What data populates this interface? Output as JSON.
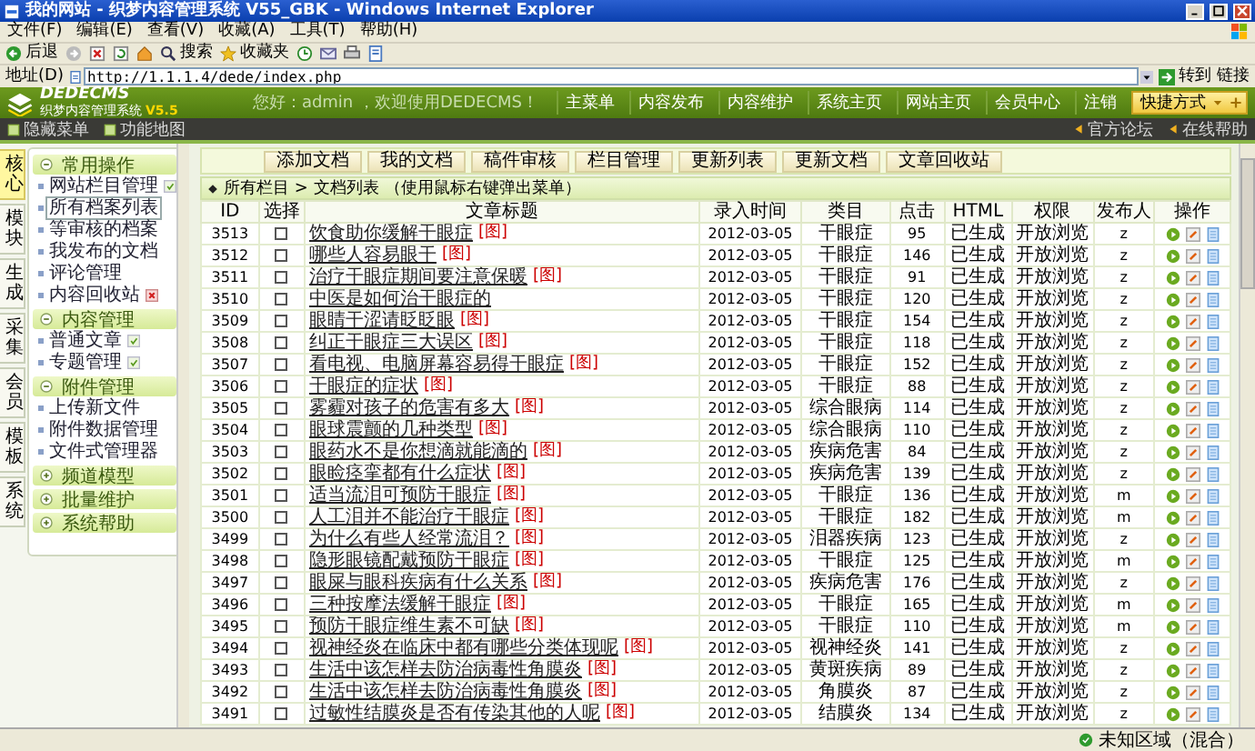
{
  "browser": {
    "title": "我的网站 - 织梦内容管理系统 V55_GBK - Windows Internet Explorer",
    "menu": [
      "文件(F)",
      "编辑(E)",
      "查看(V)",
      "收藏(A)",
      "工具(T)",
      "帮助(H)"
    ],
    "back": "后退",
    "search": "搜索",
    "favorites": "收藏夹",
    "address_label": "地址(D)",
    "url": "http://1.1.1.4/dede/index.php",
    "go": "转到",
    "links": "链接",
    "status": "未知区域（混合）"
  },
  "header": {
    "logo": "DEDECMS",
    "subtitle": "织梦内容管理系统",
    "version": "V5.5",
    "greeting": "您好：admin ，欢迎使用DEDECMS！",
    "nav": [
      "主菜单",
      "内容发布",
      "内容维护",
      "系统主页",
      "网站主页",
      "会员中心",
      "注销"
    ],
    "shortcut": "快捷方式"
  },
  "subbar": {
    "left": [
      "隐藏菜单",
      "功能地图"
    ],
    "right": [
      "官方论坛",
      "在线帮助"
    ]
  },
  "side_tabs": [
    {
      "label": "核心",
      "selected": true
    },
    {
      "label": "模块",
      "selected": false
    },
    {
      "label": "生成",
      "selected": false
    },
    {
      "label": "采集",
      "selected": false
    },
    {
      "label": "会员",
      "selected": false
    },
    {
      "label": "模板",
      "selected": false
    },
    {
      "label": "系统",
      "selected": false
    }
  ],
  "menu_groups": [
    {
      "title": "常用操作",
      "expanded": true,
      "items": [
        {
          "label": "网站栏目管理",
          "kind": "add",
          "selected": false
        },
        {
          "label": "所有档案列表",
          "kind": "plain",
          "selected": true
        },
        {
          "label": "等审核的档案",
          "kind": "plain",
          "selected": false
        },
        {
          "label": "我发布的文档",
          "kind": "plain",
          "selected": false
        },
        {
          "label": "评论管理",
          "kind": "plain",
          "selected": false
        },
        {
          "label": "内容回收站",
          "kind": "delete",
          "selected": false
        }
      ]
    },
    {
      "title": "内容管理",
      "expanded": true,
      "items": [
        {
          "label": "普通文章",
          "kind": "add",
          "selected": false
        },
        {
          "label": "专题管理",
          "kind": "add",
          "selected": false
        }
      ]
    },
    {
      "title": "附件管理",
      "expanded": true,
      "items": [
        {
          "label": "上传新文件",
          "kind": "plain",
          "selected": false
        },
        {
          "label": "附件数据管理",
          "kind": "plain",
          "selected": false
        },
        {
          "label": "文件式管理器",
          "kind": "plain",
          "selected": false
        }
      ]
    },
    {
      "title": "频道模型",
      "expanded": false
    },
    {
      "title": "批量维护",
      "expanded": false
    },
    {
      "title": "系统帮助",
      "expanded": false
    }
  ],
  "toolbar_buttons": [
    "添加文档",
    "我的文档",
    "稿件审核",
    "栏目管理",
    "更新列表",
    "更新文档",
    "文章回收站"
  ],
  "breadcrumb": "所有栏目 > 文档列表",
  "hint": "（使用鼠标右键弹出菜单）",
  "table": {
    "columns": [
      "ID",
      "选择",
      "文章标题",
      "录入时间",
      "类目",
      "点击",
      "HTML",
      "权限",
      "发布人",
      "操作"
    ],
    "rows": [
      {
        "id": "3513",
        "checked": false,
        "title": "饮食助你缓解干眼症",
        "flag": "[图]",
        "date": "2012-03-05",
        "category": "干眼症",
        "clicks": "95",
        "html": "已生成",
        "access": "开放浏览",
        "author": "z"
      },
      {
        "id": "3512",
        "checked": false,
        "title": "哪些人容易眼干",
        "flag": "[图]",
        "date": "2012-03-05",
        "category": "干眼症",
        "clicks": "146",
        "html": "已生成",
        "access": "开放浏览",
        "author": "z"
      },
      {
        "id": "3511",
        "checked": false,
        "title": "治疗干眼症期间要注意保暖",
        "flag": "[图]",
        "date": "2012-03-05",
        "category": "干眼症",
        "clicks": "91",
        "html": "已生成",
        "access": "开放浏览",
        "author": "z"
      },
      {
        "id": "3510",
        "checked": false,
        "title": "中医是如何治干眼症的",
        "date": "2012-03-05",
        "category": "干眼症",
        "clicks": "120",
        "html": "已生成",
        "access": "开放浏览",
        "author": "z"
      },
      {
        "id": "3509",
        "checked": false,
        "title": "眼睛干涩请眨眨眼",
        "flag": "[图]",
        "date": "2012-03-05",
        "category": "干眼症",
        "clicks": "154",
        "html": "已生成",
        "access": "开放浏览",
        "author": "z"
      },
      {
        "id": "3508",
        "checked": false,
        "title": "纠正干眼症三大误区",
        "flag": "[图]",
        "date": "2012-03-05",
        "category": "干眼症",
        "clicks": "118",
        "html": "已生成",
        "access": "开放浏览",
        "author": "z"
      },
      {
        "id": "3507",
        "checked": false,
        "title": "看电视、电脑屏幕容易得干眼症",
        "flag": "[图]",
        "date": "2012-03-05",
        "category": "干眼症",
        "clicks": "152",
        "html": "已生成",
        "access": "开放浏览",
        "author": "z"
      },
      {
        "id": "3506",
        "checked": false,
        "title": "干眼症的症状",
        "flag": "[图]",
        "date": "2012-03-05",
        "category": "干眼症",
        "clicks": "88",
        "html": "已生成",
        "access": "开放浏览",
        "author": "z"
      },
      {
        "id": "3505",
        "checked": false,
        "title": "雾霾对孩子的危害有多大",
        "flag": "[图]",
        "date": "2012-03-05",
        "category": "综合眼病",
        "clicks": "114",
        "html": "已生成",
        "access": "开放浏览",
        "author": "z"
      },
      {
        "id": "3504",
        "checked": false,
        "title": "眼球震颤的几种类型",
        "flag": "[图]",
        "date": "2012-03-05",
        "category": "综合眼病",
        "clicks": "110",
        "html": "已生成",
        "access": "开放浏览",
        "author": "z"
      },
      {
        "id": "3503",
        "checked": false,
        "title": "眼药水不是你想滴就能滴的",
        "flag": "[图]",
        "date": "2012-03-05",
        "category": "疾病危害",
        "clicks": "84",
        "html": "已生成",
        "access": "开放浏览",
        "author": "z"
      },
      {
        "id": "3502",
        "checked": false,
        "title": "眼睑痉挛都有什么症状",
        "flag": "[图]",
        "date": "2012-03-05",
        "category": "疾病危害",
        "clicks": "139",
        "html": "已生成",
        "access": "开放浏览",
        "author": "z"
      },
      {
        "id": "3501",
        "checked": false,
        "title": "适当流泪可预防干眼症",
        "flag": "[图]",
        "date": "2012-03-05",
        "category": "干眼症",
        "clicks": "136",
        "html": "已生成",
        "access": "开放浏览",
        "author": "m"
      },
      {
        "id": "3500",
        "checked": false,
        "title": "人工泪并不能治疗干眼症",
        "flag": "[图]",
        "date": "2012-03-05",
        "category": "干眼症",
        "clicks": "182",
        "html": "已生成",
        "access": "开放浏览",
        "author": "m"
      },
      {
        "id": "3499",
        "checked": false,
        "title": "为什么有些人经常流泪？",
        "flag": "[图]",
        "date": "2012-03-05",
        "category": "泪器疾病",
        "clicks": "123",
        "html": "已生成",
        "access": "开放浏览",
        "author": "z"
      },
      {
        "id": "3498",
        "checked": false,
        "title": "隐形眼镜配戴预防干眼症",
        "flag": "[图]",
        "date": "2012-03-05",
        "category": "干眼症",
        "clicks": "125",
        "html": "已生成",
        "access": "开放浏览",
        "author": "m"
      },
      {
        "id": "3497",
        "checked": false,
        "title": "眼屎与眼科疾病有什么关系",
        "flag": "[图]",
        "date": "2012-03-05",
        "category": "疾病危害",
        "clicks": "176",
        "html": "已生成",
        "access": "开放浏览",
        "author": "z"
      },
      {
        "id": "3496",
        "checked": false,
        "title": "三种按摩法缓解干眼症",
        "flag": "[图]",
        "date": "2012-03-05",
        "category": "干眼症",
        "clicks": "165",
        "html": "已生成",
        "access": "开放浏览",
        "author": "m"
      },
      {
        "id": "3495",
        "checked": false,
        "title": "预防干眼症维生素不可缺",
        "flag": "[图]",
        "date": "2012-03-05",
        "category": "干眼症",
        "clicks": "110",
        "html": "已生成",
        "access": "开放浏览",
        "author": "m"
      },
      {
        "id": "3494",
        "checked": false,
        "title": "视神经炎在临床中都有哪些分类体现呢",
        "flag": "[图]",
        "date": "2012-03-05",
        "category": "视神经炎",
        "clicks": "141",
        "html": "已生成",
        "access": "开放浏览",
        "author": "z"
      },
      {
        "id": "3493",
        "checked": false,
        "title": "生活中该怎样去防治病毒性角膜炎",
        "flag": "[图]",
        "date": "2012-03-05",
        "category": "黄斑疾病",
        "clicks": "89",
        "html": "已生成",
        "access": "开放浏览",
        "author": "z"
      },
      {
        "id": "3492",
        "checked": false,
        "title": "生活中该怎样去防治病毒性角膜炎",
        "flag": "[图]",
        "date": "2012-03-05",
        "category": "角膜炎",
        "clicks": "87",
        "html": "已生成",
        "access": "开放浏览",
        "author": "z"
      },
      {
        "id": "3491",
        "checked": false,
        "title": "过敏性结膜炎是否有传染其他的人呢",
        "flag": "[图]",
        "date": "2012-03-05",
        "category": "结膜炎",
        "clicks": "134",
        "html": "已生成",
        "access": "开放浏览",
        "author": "z"
      }
    ]
  }
}
